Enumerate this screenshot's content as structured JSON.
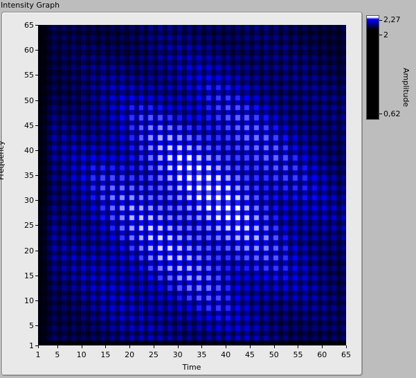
{
  "window": {
    "title": "Intensity Graph"
  },
  "chart_data": {
    "type": "heatmap",
    "xlabel": "Time",
    "ylabel": "Frequency",
    "xlim": [
      1,
      65
    ],
    "ylim": [
      1,
      65
    ],
    "x_ticks": [
      "1",
      "5",
      "10",
      "15",
      "20",
      "25",
      "30",
      "35",
      "40",
      "45",
      "50",
      "55",
      "60",
      "65"
    ],
    "y_ticks": [
      "65",
      "60",
      "55",
      "50",
      "45",
      "40",
      "35",
      "30",
      "25",
      "20",
      "15",
      "10",
      "5",
      "1"
    ],
    "colorbar": {
      "label": "Amplitude",
      "max": "2,27",
      "mid": "2",
      "min": "0,62",
      "colors": [
        "#000000",
        "#0000ff",
        "#ffffff"
      ]
    },
    "grid": false
  }
}
